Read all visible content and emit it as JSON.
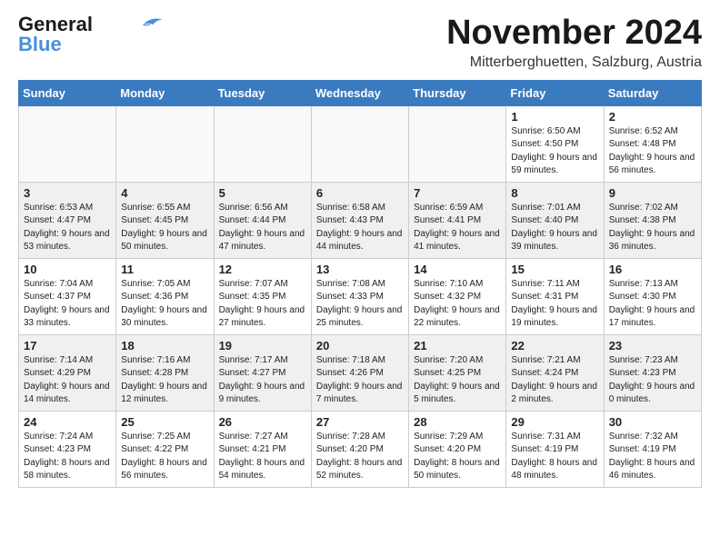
{
  "logo": {
    "general": "General",
    "blue": "Blue"
  },
  "header": {
    "month": "November 2024",
    "location": "Mitterberghuetten, Salzburg, Austria"
  },
  "columns": [
    "Sunday",
    "Monday",
    "Tuesday",
    "Wednesday",
    "Thursday",
    "Friday",
    "Saturday"
  ],
  "weeks": [
    [
      {
        "day": "",
        "info": ""
      },
      {
        "day": "",
        "info": ""
      },
      {
        "day": "",
        "info": ""
      },
      {
        "day": "",
        "info": ""
      },
      {
        "day": "",
        "info": ""
      },
      {
        "day": "1",
        "info": "Sunrise: 6:50 AM\nSunset: 4:50 PM\nDaylight: 9 hours and 59 minutes."
      },
      {
        "day": "2",
        "info": "Sunrise: 6:52 AM\nSunset: 4:48 PM\nDaylight: 9 hours and 56 minutes."
      }
    ],
    [
      {
        "day": "3",
        "info": "Sunrise: 6:53 AM\nSunset: 4:47 PM\nDaylight: 9 hours and 53 minutes."
      },
      {
        "day": "4",
        "info": "Sunrise: 6:55 AM\nSunset: 4:45 PM\nDaylight: 9 hours and 50 minutes."
      },
      {
        "day": "5",
        "info": "Sunrise: 6:56 AM\nSunset: 4:44 PM\nDaylight: 9 hours and 47 minutes."
      },
      {
        "day": "6",
        "info": "Sunrise: 6:58 AM\nSunset: 4:43 PM\nDaylight: 9 hours and 44 minutes."
      },
      {
        "day": "7",
        "info": "Sunrise: 6:59 AM\nSunset: 4:41 PM\nDaylight: 9 hours and 41 minutes."
      },
      {
        "day": "8",
        "info": "Sunrise: 7:01 AM\nSunset: 4:40 PM\nDaylight: 9 hours and 39 minutes."
      },
      {
        "day": "9",
        "info": "Sunrise: 7:02 AM\nSunset: 4:38 PM\nDaylight: 9 hours and 36 minutes."
      }
    ],
    [
      {
        "day": "10",
        "info": "Sunrise: 7:04 AM\nSunset: 4:37 PM\nDaylight: 9 hours and 33 minutes."
      },
      {
        "day": "11",
        "info": "Sunrise: 7:05 AM\nSunset: 4:36 PM\nDaylight: 9 hours and 30 minutes."
      },
      {
        "day": "12",
        "info": "Sunrise: 7:07 AM\nSunset: 4:35 PM\nDaylight: 9 hours and 27 minutes."
      },
      {
        "day": "13",
        "info": "Sunrise: 7:08 AM\nSunset: 4:33 PM\nDaylight: 9 hours and 25 minutes."
      },
      {
        "day": "14",
        "info": "Sunrise: 7:10 AM\nSunset: 4:32 PM\nDaylight: 9 hours and 22 minutes."
      },
      {
        "day": "15",
        "info": "Sunrise: 7:11 AM\nSunset: 4:31 PM\nDaylight: 9 hours and 19 minutes."
      },
      {
        "day": "16",
        "info": "Sunrise: 7:13 AM\nSunset: 4:30 PM\nDaylight: 9 hours and 17 minutes."
      }
    ],
    [
      {
        "day": "17",
        "info": "Sunrise: 7:14 AM\nSunset: 4:29 PM\nDaylight: 9 hours and 14 minutes."
      },
      {
        "day": "18",
        "info": "Sunrise: 7:16 AM\nSunset: 4:28 PM\nDaylight: 9 hours and 12 minutes."
      },
      {
        "day": "19",
        "info": "Sunrise: 7:17 AM\nSunset: 4:27 PM\nDaylight: 9 hours and 9 minutes."
      },
      {
        "day": "20",
        "info": "Sunrise: 7:18 AM\nSunset: 4:26 PM\nDaylight: 9 hours and 7 minutes."
      },
      {
        "day": "21",
        "info": "Sunrise: 7:20 AM\nSunset: 4:25 PM\nDaylight: 9 hours and 5 minutes."
      },
      {
        "day": "22",
        "info": "Sunrise: 7:21 AM\nSunset: 4:24 PM\nDaylight: 9 hours and 2 minutes."
      },
      {
        "day": "23",
        "info": "Sunrise: 7:23 AM\nSunset: 4:23 PM\nDaylight: 9 hours and 0 minutes."
      }
    ],
    [
      {
        "day": "24",
        "info": "Sunrise: 7:24 AM\nSunset: 4:23 PM\nDaylight: 8 hours and 58 minutes."
      },
      {
        "day": "25",
        "info": "Sunrise: 7:25 AM\nSunset: 4:22 PM\nDaylight: 8 hours and 56 minutes."
      },
      {
        "day": "26",
        "info": "Sunrise: 7:27 AM\nSunset: 4:21 PM\nDaylight: 8 hours and 54 minutes."
      },
      {
        "day": "27",
        "info": "Sunrise: 7:28 AM\nSunset: 4:20 PM\nDaylight: 8 hours and 52 minutes."
      },
      {
        "day": "28",
        "info": "Sunrise: 7:29 AM\nSunset: 4:20 PM\nDaylight: 8 hours and 50 minutes."
      },
      {
        "day": "29",
        "info": "Sunrise: 7:31 AM\nSunset: 4:19 PM\nDaylight: 8 hours and 48 minutes."
      },
      {
        "day": "30",
        "info": "Sunrise: 7:32 AM\nSunset: 4:19 PM\nDaylight: 8 hours and 46 minutes."
      }
    ]
  ]
}
